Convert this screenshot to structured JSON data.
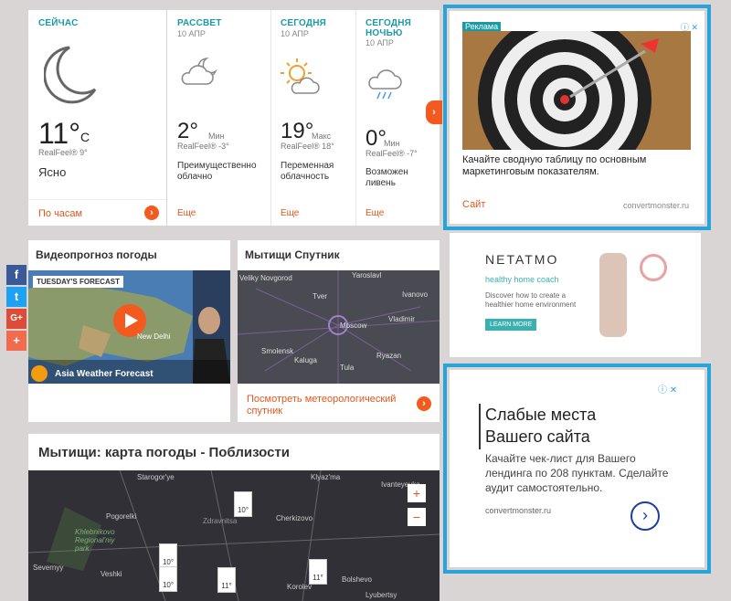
{
  "forecast": {
    "now": {
      "label": "СЕЙЧАС",
      "temp": "11°",
      "unit": "C",
      "realfeel": "RealFeel® 9°",
      "desc": "Ясно",
      "link": "По часам"
    },
    "dawn": {
      "label": "РАССВЕТ",
      "date": "10 АПР",
      "temp": "2°",
      "temp_sub": "Мин",
      "realfeel": "RealFeel® -3°",
      "desc": "Преимущественно облачно",
      "link": "Еще"
    },
    "today": {
      "label": "СЕГОДНЯ",
      "date": "10 АПР",
      "temp": "19°",
      "temp_sub": "Макс",
      "realfeel": "RealFeel® 18°",
      "desc": "Переменная облачность",
      "link": "Еще"
    },
    "tonight": {
      "label": "СЕГОДНЯ НОЧЬЮ",
      "date": "10 АПР",
      "temp": "0°",
      "temp_sub": "Мин",
      "realfeel": "RealFeel® -7°",
      "desc": "Возможен ливень",
      "link": "Еще"
    }
  },
  "video": {
    "title": "Видеопрогноз погоды",
    "badge": "TUESDAY'S FORECAST",
    "caption": "Asia Weather Forecast",
    "cities": [
      "New Delhi"
    ]
  },
  "satellite": {
    "title": "Мытищи Спутник",
    "link": "Посмотреть метеорологический спутник",
    "cities": [
      "Yaroslavl",
      "Ivanovo",
      "Tver",
      "Vladimir",
      "Moscow",
      "Veliky Novgorod",
      "Smolensk",
      "Ryazan",
      "Kaluga",
      "Tula"
    ]
  },
  "map": {
    "title": "Мытищи: карта погоды - Поблизости",
    "cities": [
      "Starogor'ye",
      "Klyaz'ma",
      "Ivanteyevka",
      "Pogorelki",
      "Khlebnikovo Regional'niy park",
      "Zdravnitsa",
      "Cherkizovo",
      "Severnyy",
      "Veshki",
      "Korolev",
      "Bolshevo",
      "Lyubertsy"
    ],
    "pins": [
      "10°",
      "10°",
      "10°",
      "11°",
      "11°"
    ],
    "zoom_in": "+",
    "zoom_out": "−"
  },
  "ad1": {
    "tag": "Реклама",
    "text": "Качайте сводную таблицу по основным маркетинговым показателям.",
    "site": "Сайт",
    "domain": "convertmonster.ru"
  },
  "ad2": {
    "brand": "NETATMO",
    "tagline": "healthy home coach",
    "text": "Discover how to create a healthier home environment",
    "button": "LEARN MORE"
  },
  "ad3": {
    "headline1": "Слабые места",
    "headline2": "Вашего сайта",
    "body": "Качайте чек-лист для Вашего лендинга по 208 пунктам. Сделайте аудит самостоятельно.",
    "domain": "convertmonster.ru"
  },
  "colors": {
    "accent": "#1a9aa8",
    "orange": "#f25a1f",
    "ad_border": "#29a3dc"
  }
}
